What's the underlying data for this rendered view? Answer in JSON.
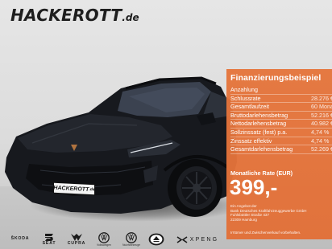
{
  "dealer": {
    "name": "HACKEROTT",
    "tld": ".de"
  },
  "plate": {
    "name": "HACKEROTT",
    "tld": ".de"
  },
  "financing": {
    "title": "Finanzierungsbeispiel",
    "rows": [
      {
        "label": "Anzahlung",
        "value": ""
      },
      {
        "label": "Schlussrate",
        "value": "28.276 €"
      },
      {
        "label": "Gesamtlaufzeit",
        "value": "60 Monate"
      },
      {
        "label": "Bruttodarlehensbetrag",
        "value": "52.216 €"
      },
      {
        "label": "Nettodarlehensbetrag",
        "value": "40.982 €"
      },
      {
        "label": "Sollzinssatz (fest) p.a.",
        "value": "4,74 %"
      },
      {
        "label": "Zinssatz effektiv",
        "value": "4,74 %"
      },
      {
        "label": "Gesamtdarlehensbetrag",
        "value": "52.269 €"
      }
    ],
    "rate_label": "Monatliche Rate (EUR)",
    "rate_value": "399,-",
    "offer_lines": [
      "Ein Angebot der",
      "Bank Deutsches Kraftfahrzeuggewerbe GmbH",
      "Fuhlsbüttler Straße 437",
      "22309 Hamburg"
    ],
    "disclaimer": "Irrtümer und Zwischenverkauf vorbehalten."
  },
  "brands": [
    {
      "icon": "skoda-logo",
      "name": "ŠKODA",
      "sub": ""
    },
    {
      "icon": "seat-logo",
      "name": "SEAT",
      "sub": ""
    },
    {
      "icon": "cupra-logo",
      "name": "CUPRA",
      "sub": ""
    },
    {
      "icon": "volkswagen-logo",
      "name": "",
      "sub": "Volkswagen"
    },
    {
      "icon": "vw-commercial-logo",
      "name": "",
      "sub": "Nutzfahrzeuge"
    },
    {
      "icon": "lotus-logo",
      "name": "",
      "sub": ""
    },
    {
      "icon": "xpeng-logo",
      "name": "XPENG",
      "sub": ""
    }
  ],
  "colors": {
    "panel": "#e5753c",
    "text_on_panel": "#ffffff",
    "car": "#16181d",
    "copper_accent": "#b0733f"
  }
}
